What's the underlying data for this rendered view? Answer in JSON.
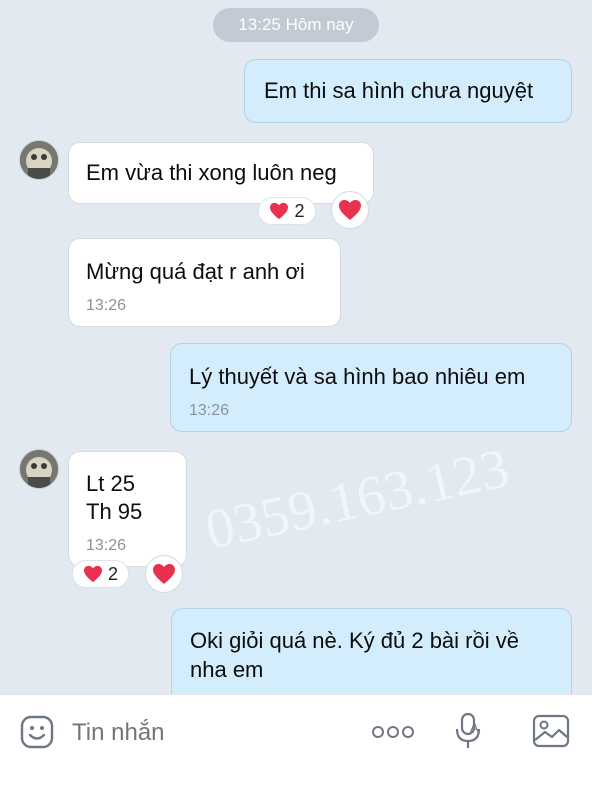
{
  "chat": {
    "date_chip": "13:25 Hôm nay",
    "messages": [
      {
        "text": "Em thi sa hình chưa nguyệt"
      },
      {
        "text": "Em vừa thi xong luôn neg",
        "reaction_count": "2"
      },
      {
        "text": "Mừng quá đạt r anh ơi",
        "time": "13:26"
      },
      {
        "text": "Lý thuyết và sa hình bao nhiêu em",
        "time": "13:26"
      },
      {
        "line1": "Lt 25",
        "line2": "Th 95",
        "time": "13:26",
        "reaction_count": "2"
      },
      {
        "line1": "Oki giỏi quá nè. Ký đủ 2 bài rồi về",
        "line2": "nha em"
      }
    ],
    "watermark": "0359.163.123"
  },
  "input": {
    "placeholder": "Tin nhắn"
  },
  "icons": {
    "emoji": "emoji-icon",
    "more": "more-icon",
    "voice": "voice-text-icon",
    "image": "image-icon",
    "heart": "heart-icon"
  },
  "colors": {
    "background": "#e2e9f1",
    "outgoing_bubble": "#d4edfd",
    "incoming_bubble": "#ffffff",
    "heart": "#e8304f"
  }
}
